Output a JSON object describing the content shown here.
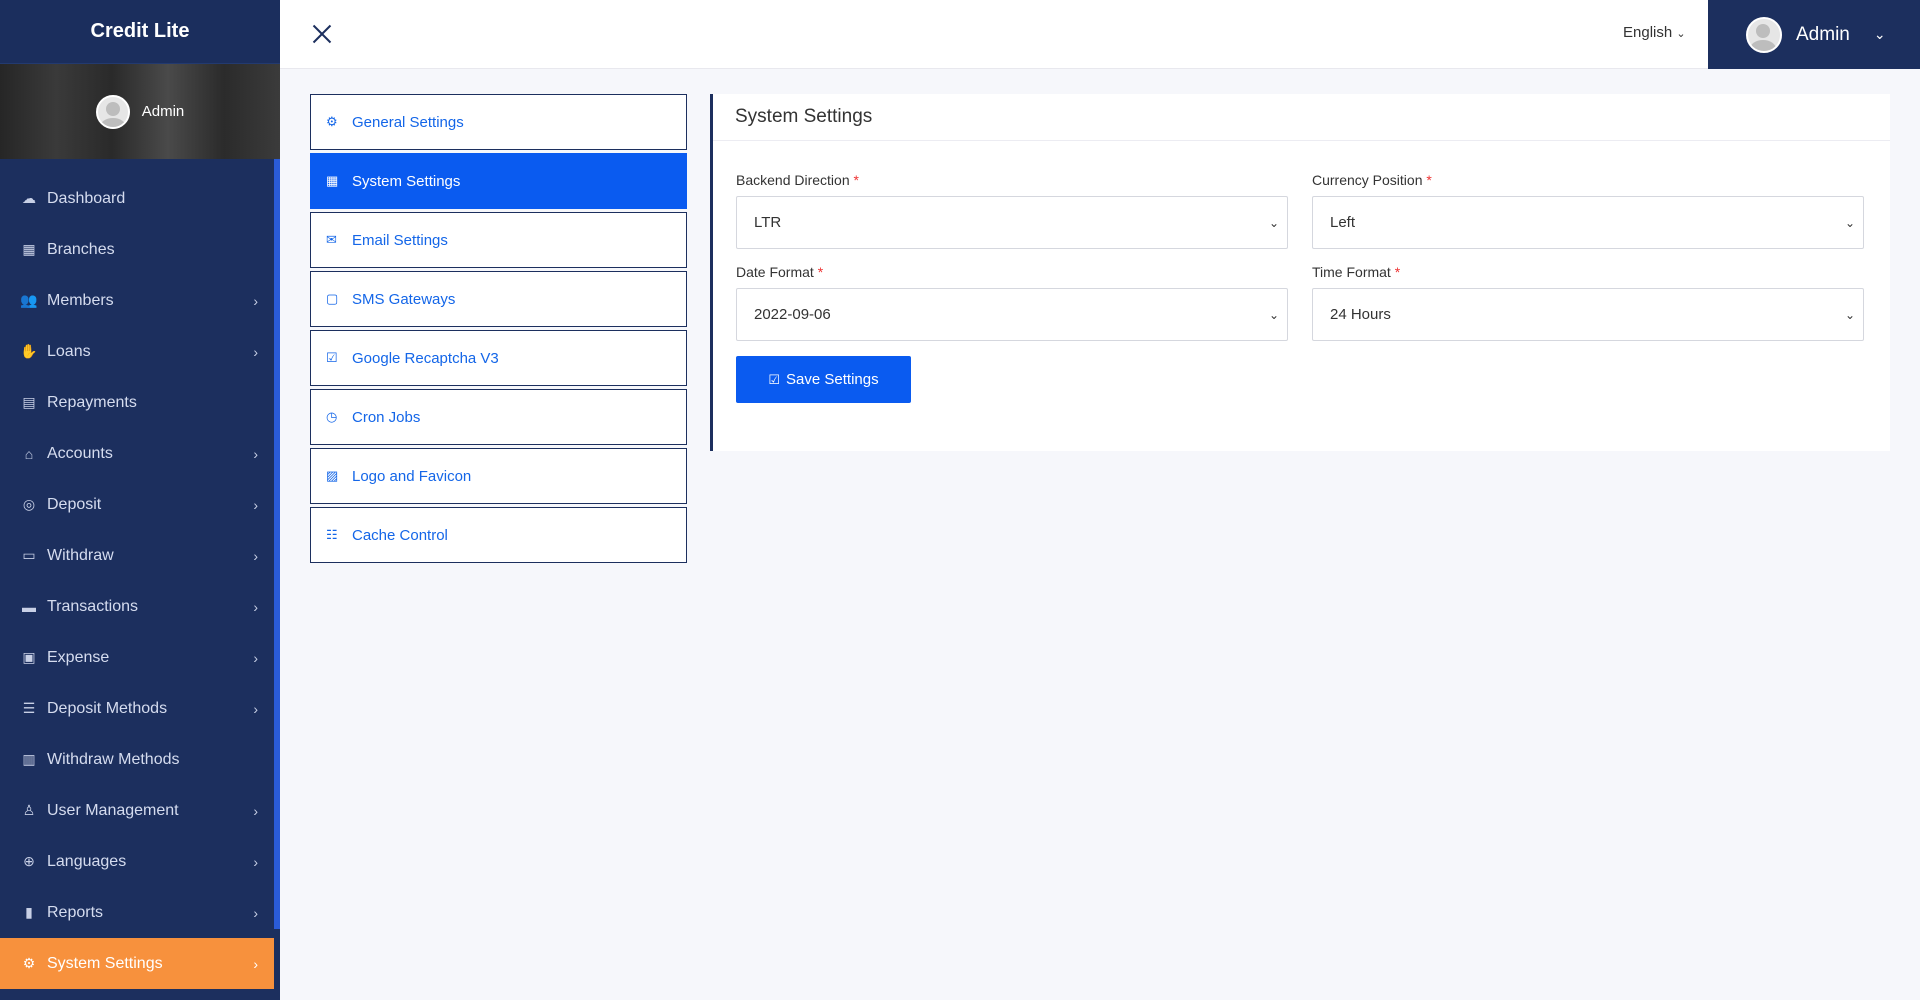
{
  "app": {
    "brand": "Credit Lite",
    "profile_name": "Admin"
  },
  "header": {
    "language": "English",
    "user": "Admin"
  },
  "sidebar": {
    "items": [
      {
        "label": "Dashboard",
        "icon": "cloud-icon",
        "glyph": "☁",
        "chevron": false
      },
      {
        "label": "Branches",
        "icon": "building-icon",
        "glyph": "▦",
        "chevron": false
      },
      {
        "label": "Members",
        "icon": "users-icon",
        "glyph": "👥",
        "chevron": true
      },
      {
        "label": "Loans",
        "icon": "hand-coin-icon",
        "glyph": "✋",
        "chevron": true
      },
      {
        "label": "Repayments",
        "icon": "receipt-icon",
        "glyph": "▤",
        "chevron": false
      },
      {
        "label": "Accounts",
        "icon": "bank-icon",
        "glyph": "⌂",
        "chevron": true
      },
      {
        "label": "Deposit",
        "icon": "coins-icon",
        "glyph": "◎",
        "chevron": true
      },
      {
        "label": "Withdraw",
        "icon": "card-icon",
        "glyph": "▭",
        "chevron": true
      },
      {
        "label": "Transactions",
        "icon": "wallet-icon",
        "glyph": "▬",
        "chevron": true
      },
      {
        "label": "Expense",
        "icon": "money-icon",
        "glyph": "▣",
        "chevron": true
      },
      {
        "label": "Deposit Methods",
        "icon": "list-icon",
        "glyph": "☰",
        "chevron": true
      },
      {
        "label": "Withdraw Methods",
        "icon": "clipboard-icon",
        "glyph": "▥",
        "chevron": false
      },
      {
        "label": "User Management",
        "icon": "user-icon",
        "glyph": "♙",
        "chevron": true
      },
      {
        "label": "Languages",
        "icon": "globe-icon",
        "glyph": "⊕",
        "chevron": true
      },
      {
        "label": "Reports",
        "icon": "bar-chart-icon",
        "glyph": "▮",
        "chevron": true
      },
      {
        "label": "System Settings",
        "icon": "gear-icon",
        "glyph": "⚙",
        "chevron": true,
        "active": true
      }
    ]
  },
  "tabs": [
    {
      "label": "General Settings",
      "icon": "gear-icon",
      "glyph": "⚙"
    },
    {
      "label": "System Settings",
      "icon": "window-icon",
      "glyph": "▦",
      "active": true
    },
    {
      "label": "Email Settings",
      "icon": "envelope-icon",
      "glyph": "✉"
    },
    {
      "label": "SMS Gateways",
      "icon": "chat-icon",
      "glyph": "▢"
    },
    {
      "label": "Google Recaptcha V3",
      "icon": "check-square-icon",
      "glyph": "☑"
    },
    {
      "label": "Cron Jobs",
      "icon": "clock-icon",
      "glyph": "◷"
    },
    {
      "label": "Logo and Favicon",
      "icon": "image-icon",
      "glyph": "▨"
    },
    {
      "label": "Cache Control",
      "icon": "database-icon",
      "glyph": "☷"
    }
  ],
  "card": {
    "title": "System Settings",
    "fields": {
      "backend_direction": {
        "label": "Backend Direction",
        "value": "LTR"
      },
      "currency_position": {
        "label": "Currency Position",
        "value": "Left"
      },
      "date_format": {
        "label": "Date Format",
        "value": "2022-09-06"
      },
      "time_format": {
        "label": "Time Format",
        "value": "24 Hours"
      }
    },
    "required_mark": "*",
    "save_label": "Save Settings"
  },
  "colors": {
    "sidebar": "#1c2f5e",
    "active_menu": "#f7913d",
    "primary": "#0a5bf0"
  }
}
